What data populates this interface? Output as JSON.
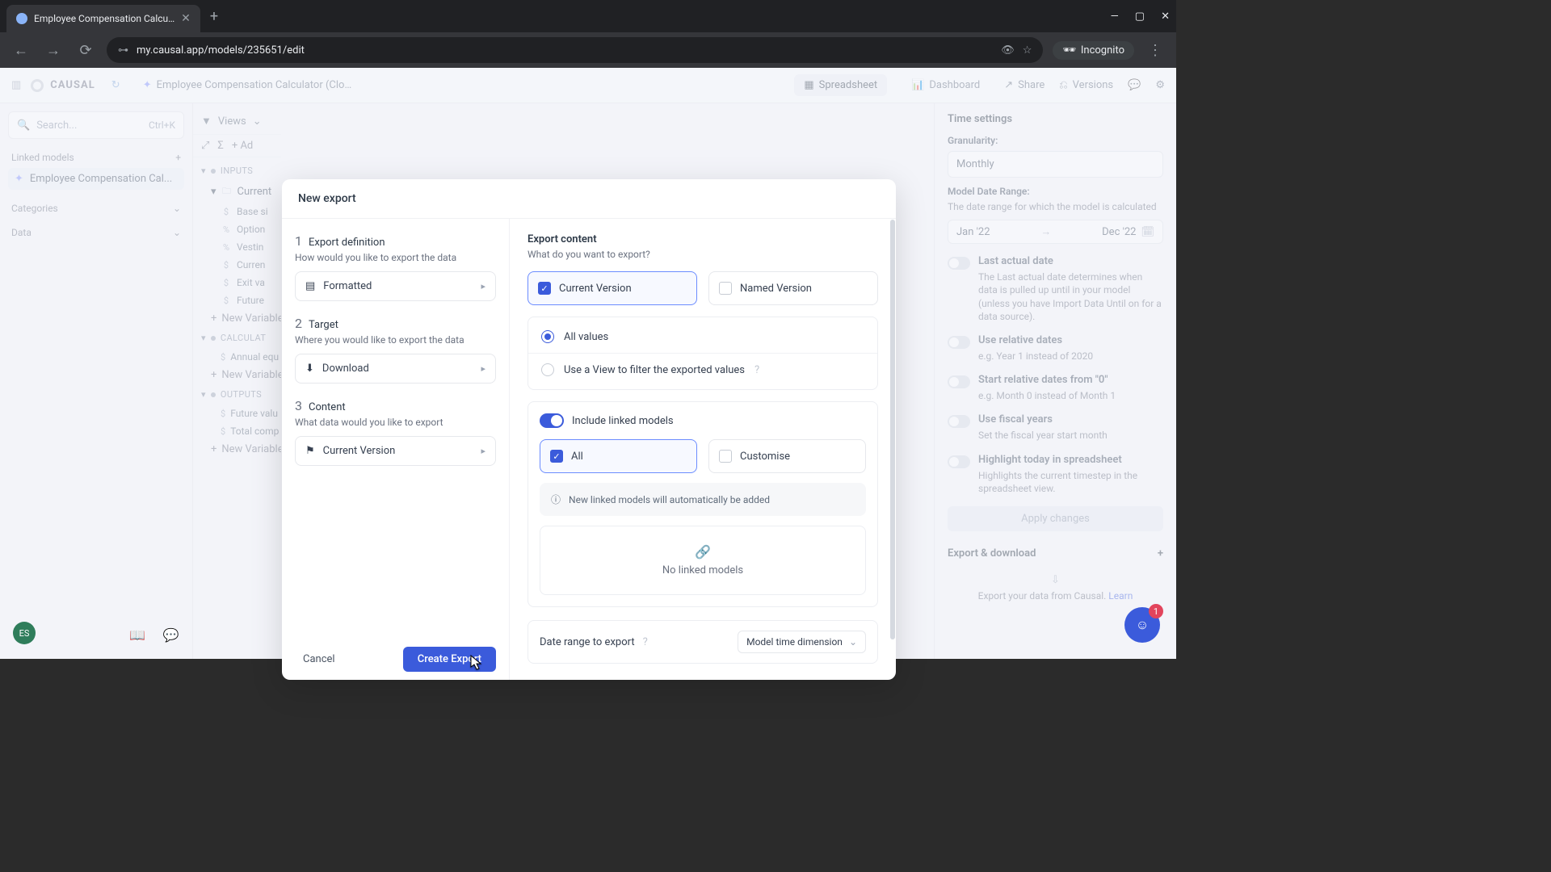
{
  "browser": {
    "tab_title": "Employee Compensation Calcu…",
    "url": "my.causal.app/models/235651/edit",
    "incognito": "Incognito"
  },
  "topbar": {
    "brand": "CAUSAL",
    "breadcrumb": "Employee Compensation Calculator (Clo…",
    "spreadsheet": "Spreadsheet",
    "dashboard": "Dashboard",
    "share": "Share",
    "versions": "Versions"
  },
  "left": {
    "search_placeholder": "Search...",
    "search_kbd": "Ctrl+K",
    "linked_models": "Linked models",
    "linked_item": "Employee Compensation Cal...",
    "categories": "Categories",
    "data": "Data"
  },
  "mid": {
    "views": "Views",
    "add": "Ad",
    "inputs_hdr": "INPUTS",
    "current_folder": "Current",
    "items": {
      "base": "Base si",
      "option": "Option",
      "vesting": "Vestin",
      "curren2": "Curren",
      "exit": "Exit va",
      "future": "Future"
    },
    "new_var": "New Variable",
    "calc_hdr": "CALCULAT",
    "annual": "Annual equ",
    "outputs_hdr": "OUTPUTS",
    "future_val": "Future valu",
    "total": "Total comp"
  },
  "right": {
    "title": "Time settings",
    "granularity": "Granularity:",
    "gran_val": "Monthly",
    "range_lbl": "Model Date Range:",
    "range_desc": "The date range for which the model is calculated",
    "start": "Jan '22",
    "end": "Dec '22",
    "t1": "Last actual date",
    "t1d": "The Last actual date determines when data is pulled up until in your model (unless you have Import Data Until on for a data source).",
    "t2": "Use relative dates",
    "t2d": "e.g. Year 1 instead of 2020",
    "t3": "Start relative dates from \"0\"",
    "t3d": "e.g. Month 0 instead of Month 1",
    "t4": "Use fiscal years",
    "t4d": "Set the fiscal year start month",
    "t5": "Highlight today in spreadsheet",
    "t5d": "Highlights the current timestep in the spreadsheet view.",
    "apply": "Apply changes",
    "export_hdr": "Export & download",
    "export_desc": "Export your data from Causal.",
    "learn": "Learn"
  },
  "modal": {
    "title": "New export",
    "step1": {
      "name": "Export definition",
      "sub": "How would you like to export the data",
      "val": "Formatted"
    },
    "step2": {
      "name": "Target",
      "sub": "Where you would like to export the data",
      "val": "Download"
    },
    "step3": {
      "name": "Content",
      "sub": "What data would you like to export",
      "val": "Current Version"
    },
    "cancel": "Cancel",
    "create": "Create Export",
    "right": {
      "h": "Export content",
      "sub": "What do you want to export?",
      "current_version": "Current Version",
      "named_version": "Named Version",
      "all_values": "All values",
      "use_view": "Use a View to filter the exported values",
      "include_linked": "Include linked models",
      "all": "All",
      "customise": "Customise",
      "info": "New linked models will automatically be added",
      "empty": "No linked models",
      "date_range": "Date range to export",
      "dr_val": "Model time dimension"
    }
  },
  "misc": {
    "avatar": "ES",
    "badge": "1",
    "date_badge": "22"
  }
}
